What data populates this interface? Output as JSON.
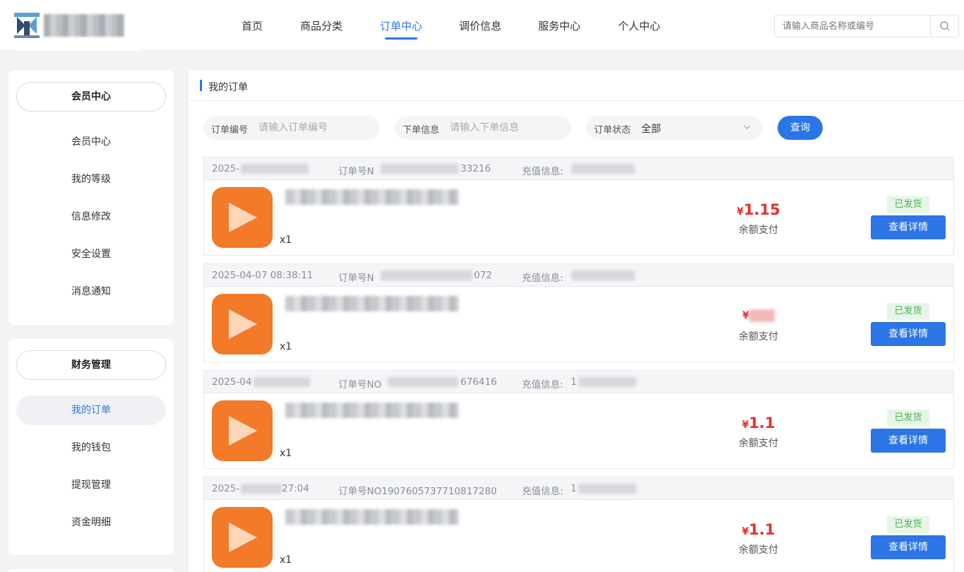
{
  "header": {
    "nav": [
      {
        "label": "首页"
      },
      {
        "label": "商品分类"
      },
      {
        "label": "订单中心"
      },
      {
        "label": "调价信息"
      },
      {
        "label": "服务中心"
      },
      {
        "label": "个人中心"
      }
    ],
    "active_nav": "订单中心",
    "search_placeholder": "请输入商品名称或编号"
  },
  "sidebar": {
    "member": {
      "title": "会员中心",
      "items": [
        {
          "label": "会员中心"
        },
        {
          "label": "我的等级"
        },
        {
          "label": "信息修改"
        },
        {
          "label": "安全设置"
        },
        {
          "label": "消息通知"
        }
      ]
    },
    "finance": {
      "title": "财务管理",
      "items": [
        {
          "label": "我的订单"
        },
        {
          "label": "我的钱包"
        },
        {
          "label": "提现管理"
        },
        {
          "label": "资金明细"
        }
      ]
    }
  },
  "main": {
    "title": "我的订单",
    "filters": {
      "order_no_label": "订单编号",
      "order_no_placeholder": "请输入订单编号",
      "order_info_label": "下单信息",
      "order_info_placeholder": "请输入下单信息",
      "status_label": "订单状态",
      "status_value": "全部"
    },
    "query_label": "查询",
    "orders": [
      {
        "date": "2025-",
        "order_no_prefix": "订单号N",
        "order_no_suffix": "33216",
        "recharge_label": "充值信息:",
        "qty": "x1",
        "currency": "¥",
        "price": "1.15",
        "pay_method": "余额支付",
        "status": "已发货",
        "detail_label": "查看详情"
      },
      {
        "date": "2025-04-07 08:38:11",
        "order_no_prefix": "订单号N",
        "order_no_suffix": "072",
        "recharge_label": "充值信息:",
        "qty": "x1",
        "currency": "¥",
        "price": "",
        "pay_method": "余额支付",
        "status": "已发货",
        "detail_label": "查看详情"
      },
      {
        "date": "2025-04",
        "order_no_prefix": "订单号NO",
        "order_no_suffix": "676416",
        "recharge_label": "充值信息:",
        "recharge_value": "1",
        "qty": "x1",
        "currency": "¥",
        "price": "1.1",
        "pay_method": "余额支付",
        "status": "已发货",
        "detail_label": "查看详情"
      },
      {
        "date": "2025-",
        "date_tail": "27:04",
        "order_no_prefix": "订单号NO1907605737710817280",
        "order_no_suffix": "",
        "recharge_label": "充值信息:",
        "recharge_value": "1",
        "qty": "x1",
        "currency": "¥",
        "price": "1.1",
        "pay_method": "余额支付",
        "status": "已发货",
        "detail_label": "查看详情"
      }
    ]
  },
  "colors": {
    "accent": "#2b75e6",
    "price": "#e8302e",
    "status_bg": "#e6f6e6",
    "status_text": "#48b34a",
    "thumb": "#f27a28"
  },
  "icons": {
    "logo": "logo-mark",
    "search": "search-icon",
    "chevron": "chevron-down-icon",
    "thumb": "play-icon"
  }
}
